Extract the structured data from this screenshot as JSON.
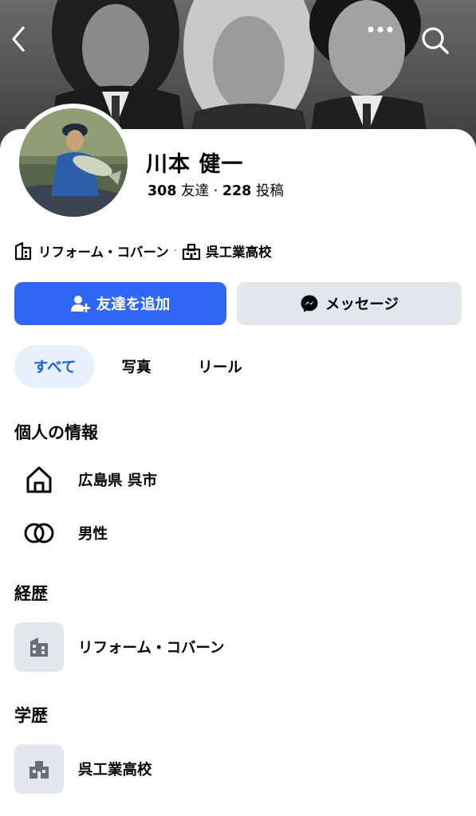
{
  "profile": {
    "name": "川本 健一",
    "friends_count": "308",
    "friends_label": "友達",
    "posts_count": "228",
    "posts_label": "投稿"
  },
  "info_line": {
    "work": "リフォーム・コバーン",
    "school": "呉工業高校"
  },
  "actions": {
    "add_friend": "友達を追加",
    "message": "メッセージ"
  },
  "tabs": [
    {
      "label": "すべて",
      "active": true
    },
    {
      "label": "写真"
    },
    {
      "label": "リール"
    }
  ],
  "sections": {
    "personal": {
      "title": "個人の情報",
      "hometown": "広島県 呉市",
      "gender": "男性"
    },
    "work": {
      "title": "経歴",
      "employer": "リフォーム・コバーン"
    },
    "education": {
      "title": "学歴",
      "school": "呉工業高校"
    }
  },
  "icons": {
    "back": "chevron-left-icon",
    "more": "more-dots-icon",
    "search": "search-icon",
    "home": "home-icon",
    "gender": "gender-rings-icon",
    "work": "building-icon",
    "school": "school-icon",
    "add_friend": "add-person-icon",
    "messenger": "messenger-icon"
  },
  "colors": {
    "primary_button": "#2f66f4",
    "secondary_button": "#e4e6eb",
    "active_tab_bg": "#e7f0fd",
    "active_tab_text": "#1d5fd6"
  }
}
